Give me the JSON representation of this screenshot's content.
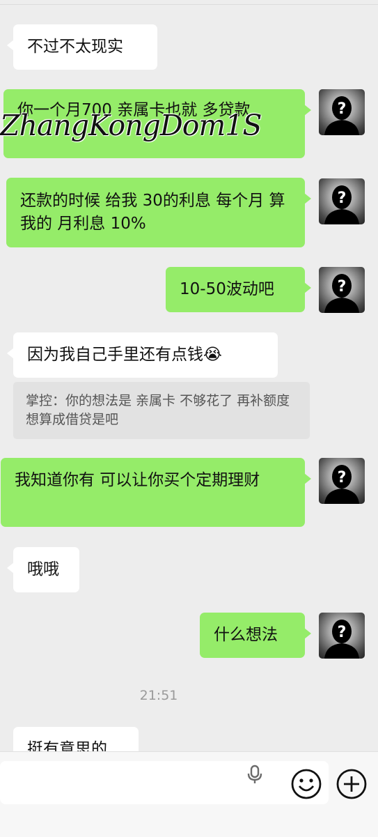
{
  "messages": [
    {
      "side": "left",
      "text": "不过不太现实"
    },
    {
      "side": "right",
      "text": "你一个月700 亲属卡也就 多贷款"
    },
    {
      "side": "right",
      "text": "还款的时候 给我 30的利息 每个月 算我的 月利息 10%"
    },
    {
      "side": "right",
      "text": "10-50波动吧"
    },
    {
      "side": "left",
      "text": "因为我自己手里还有点钱😭"
    },
    {
      "side": "right",
      "text": "我知道你有 可以让你买个定期理财"
    },
    {
      "side": "left",
      "text": "哦哦"
    },
    {
      "side": "right",
      "text": "什么想法"
    },
    {
      "side": "left",
      "text": "挺有意思的"
    }
  ],
  "quote": {
    "text": "掌控：你的想法是 亲属卡 不够花了 再补额度 想算成借贷是吧"
  },
  "timestamp": "21:51",
  "watermark": "ZhangKongDom1S",
  "input": {
    "placeholder": "",
    "icons": [
      "microphone-icon",
      "emoji-icon",
      "plus-icon"
    ]
  },
  "colors": {
    "background": "#ededed",
    "sent_bubble": "#95ec69",
    "received_bubble": "#ffffff"
  }
}
